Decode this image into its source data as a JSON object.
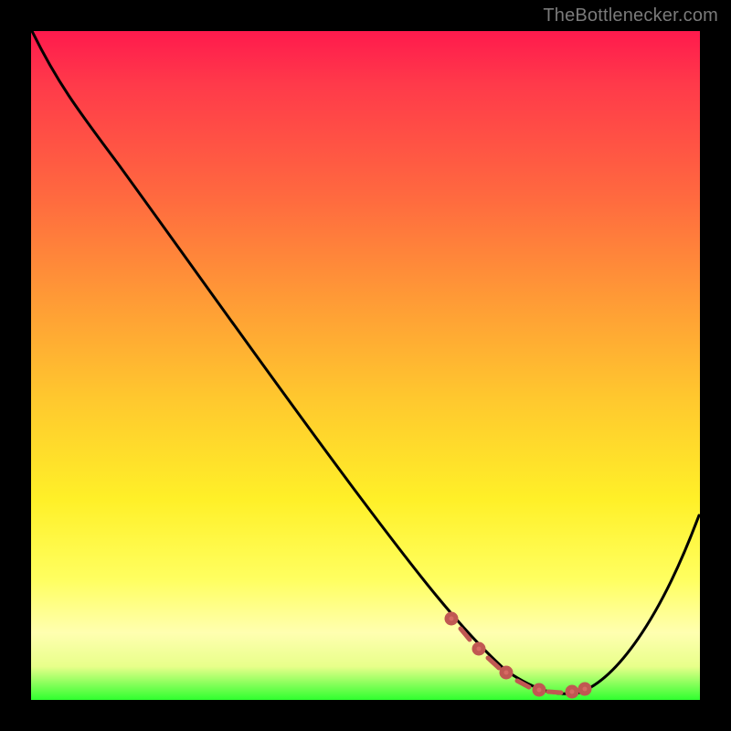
{
  "credit_text": "TheBottlenecker.com",
  "colors": {
    "frame": "#000000",
    "text": "#7a7a7a",
    "curve": "#000000",
    "marker_fill": "#d66a63",
    "marker_stroke": "#c05852"
  },
  "chart_data": {
    "type": "line",
    "title": "",
    "xlabel": "",
    "ylabel": "",
    "xlim": [
      0,
      100
    ],
    "ylim": [
      0,
      100
    ],
    "x": [
      0,
      6,
      14,
      22,
      30,
      38,
      46,
      54,
      60,
      64,
      68,
      72,
      76,
      80,
      82,
      86,
      90,
      94,
      100
    ],
    "y": [
      100,
      95,
      87,
      76.5,
      65,
      53,
      41.5,
      30,
      21,
      14.5,
      9,
      5,
      2.5,
      1.2,
      1.2,
      3,
      8,
      15,
      28
    ],
    "trough_markers_x": [
      62,
      65,
      67.5,
      70.5,
      73,
      76,
      79,
      81,
      82.5
    ],
    "trough_markers_y": [
      12,
      9.2,
      7.5,
      5,
      4,
      2.5,
      1.5,
      1.2,
      1.3
    ],
    "gradient_stops": [
      {
        "pct": 0,
        "color": "#ff1a4d"
      },
      {
        "pct": 25,
        "color": "#ff6a3f"
      },
      {
        "pct": 55,
        "color": "#ffc82e"
      },
      {
        "pct": 82,
        "color": "#ffff60"
      },
      {
        "pct": 100,
        "color": "#2fff2f"
      }
    ]
  }
}
